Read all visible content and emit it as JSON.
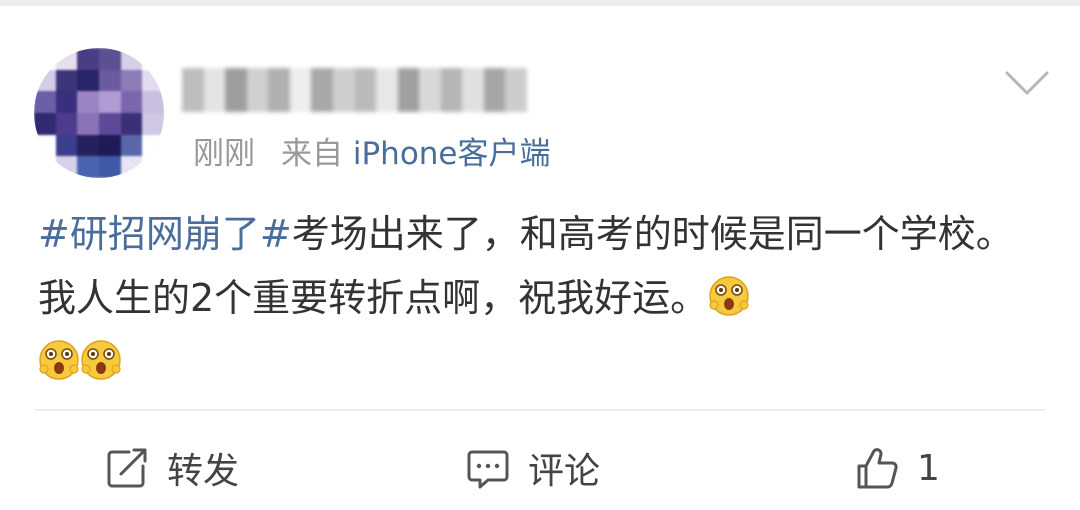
{
  "post": {
    "time": "刚刚",
    "source_prefix": "来自",
    "source_client": "iPhone客户端",
    "topic": "#研招网崩了#",
    "text": "考场出来了，和高考的时候是同一个学校。我人生的2个重要转折点啊，祝我好运。",
    "emoji_name": "surprised-face-emoji"
  },
  "actions": {
    "repost_label": "转发",
    "comment_label": "评论",
    "like_count": "1"
  },
  "colors": {
    "link": "#4a6e9c",
    "meta": "#999999",
    "text": "#333333",
    "divider": "#ececec"
  },
  "icons": {
    "more": "chevron-down-icon",
    "repost": "repost-icon",
    "comment": "comment-icon",
    "like": "thumbs-up-icon"
  }
}
